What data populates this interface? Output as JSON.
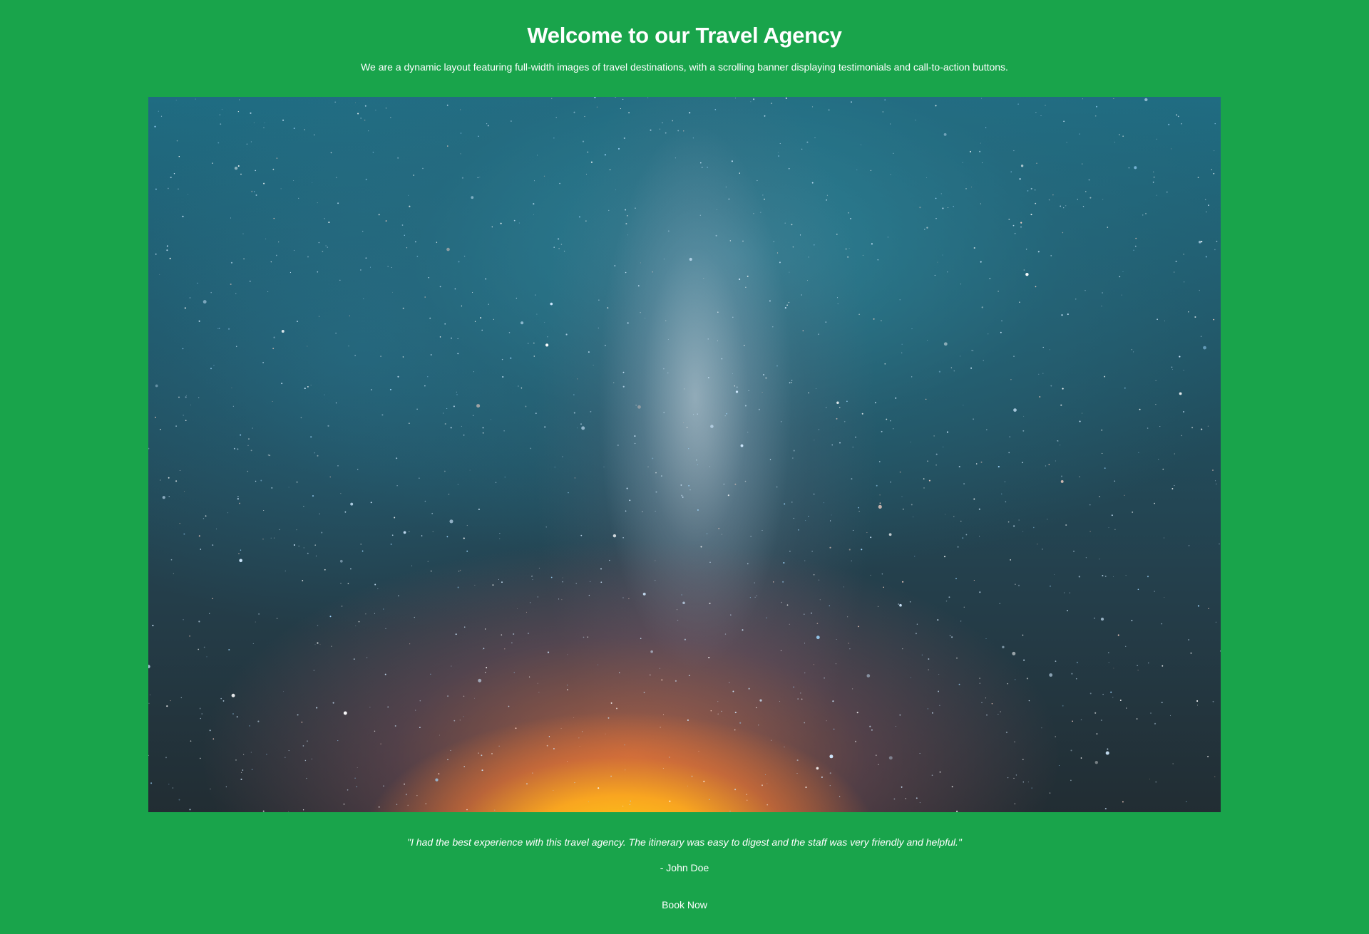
{
  "header": {
    "title": "Welcome to our Travel Agency",
    "subtitle": "We are a dynamic layout featuring full-width images of travel destinations, with a scrolling banner displaying testimonials and call-to-action buttons."
  },
  "hero": {
    "image_subject": "starry-night-sky-milky-way"
  },
  "testimonial": {
    "quote": "\"I had the best experience with this travel agency. The itinerary was easy to digest and the staff was very friendly and helpful.\"",
    "author": "- John Doe"
  },
  "cta": {
    "label": "Book Now"
  },
  "colors": {
    "background": "#19a44b",
    "text": "#ffffff"
  }
}
